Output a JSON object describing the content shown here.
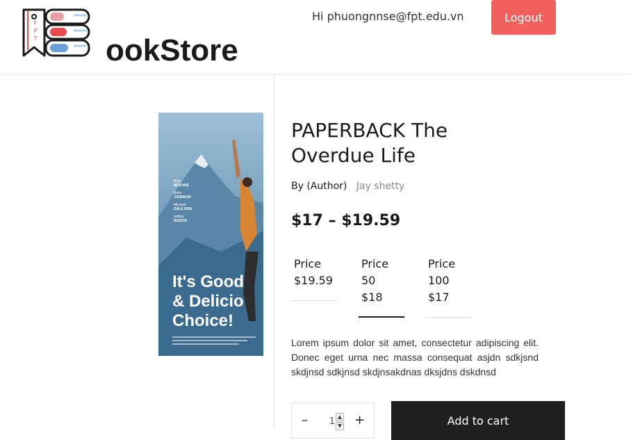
{
  "header": {
    "logo": {
      "badge_letters": [
        "F",
        "P",
        "T"
      ],
      "text": "ookStore"
    },
    "greeting": "Hi phuongnnse@fpt.edu.vn",
    "logout_label": "Logout"
  },
  "product": {
    "cover": {
      "names": [
        "Riley",
        "MCKANE",
        "Bella",
        "JOHNSON",
        "Michael",
        "DALE DON",
        "Jeffrey",
        "RADICE"
      ],
      "tagline_1": "It's Good",
      "tagline_2": "& Delicio",
      "tagline_3": "Choice!"
    },
    "title": "PAPERBACK The Overdue Life",
    "by_label": "By (Author)",
    "author": "Jay shetty",
    "price_range": "$17 – $19.59",
    "variants": [
      {
        "line1": "Price",
        "line2": "$19.59",
        "line3": ""
      },
      {
        "line1": "Price",
        "line2": "50",
        "line3": "$18"
      },
      {
        "line1": "Price",
        "line2": "100",
        "line3": "$17"
      }
    ],
    "description": "Lorem ipsum dolor sit amet, consectetur adipiscing elit. Donec eget urna nec massa consequat asjdn sdkjsnd skdjnsd sdkjnsd skdjnsakdnas dksjdns dskdnsd",
    "quantity": "1",
    "add_to_cart_label": "Add to cart"
  },
  "colors": {
    "accent": "#f0605d",
    "dark_button": "#1f1f1f",
    "muted_text": "#8a8a8a"
  }
}
